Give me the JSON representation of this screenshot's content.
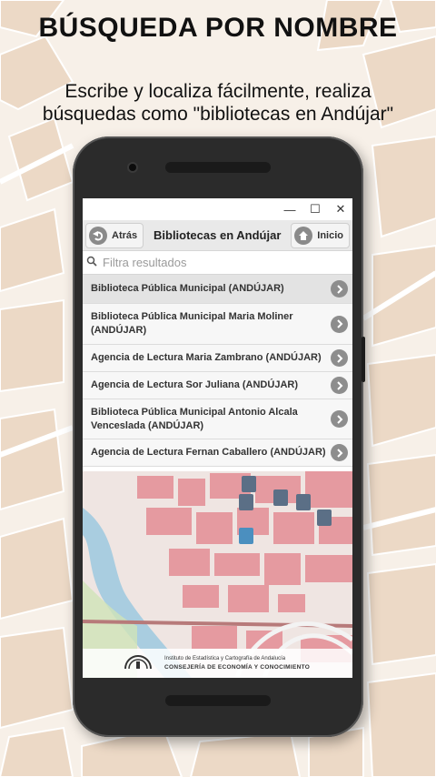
{
  "promo": {
    "title": "BÚSQUEDA POR NOMBRE",
    "subtitle": "Escribe y localiza fácilmente, realiza búsquedas como \"bibliotecas en Andújar\""
  },
  "window": {
    "minimize": "—",
    "maximize": "☐",
    "close": "✕"
  },
  "toolbar": {
    "back_label": "Atrás",
    "title": "Bibliotecas en Andújar",
    "home_label": "Inicio"
  },
  "filter": {
    "placeholder": "Filtra resultados"
  },
  "results": [
    {
      "label": "Biblioteca Pública Municipal (ANDÚJAR)"
    },
    {
      "label": "Biblioteca Pública Municipal Maria Moliner (ANDÚJAR)"
    },
    {
      "label": "Agencia de Lectura Maria Zambrano (ANDÚJAR)"
    },
    {
      "label": "Agencia de Lectura Sor Juliana (ANDÚJAR)"
    },
    {
      "label": "Biblioteca Pública Municipal Antonio Alcala Venceslada (ANDÚJAR)"
    },
    {
      "label": "Agencia de Lectura Fernan Caballero (ANDÚJAR)"
    }
  ],
  "footer": {
    "institute": "Instituto de Estadística y Cartografía de Andalucía",
    "ministry": "CONSEJERÍA DE ECONOMÍA Y CONOCIMIENTO",
    "emblem": "JUNTA DE ANDALUCÍA"
  },
  "colors": {
    "map_base": "#efe5e2",
    "map_blocks": "#e59aa0",
    "river": "#a9cde0",
    "park": "#cfe3b8",
    "bg_map_blocks": "#ead6c2"
  }
}
